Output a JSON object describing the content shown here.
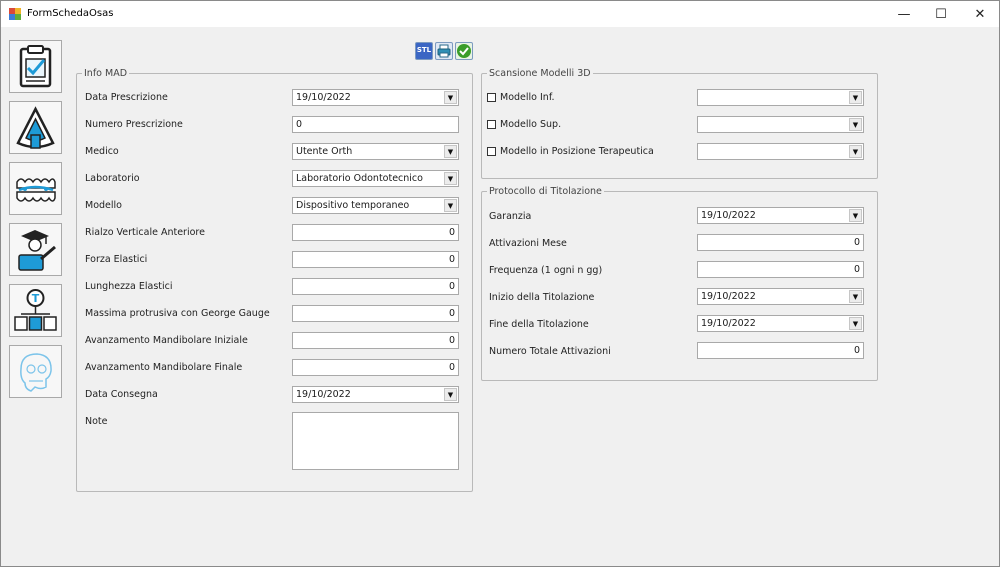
{
  "window": {
    "title": "FormSchedaOsas",
    "minimize": "—",
    "maximize": "☐",
    "close": "✕"
  },
  "toolbar": {
    "stl_label": "STL"
  },
  "info_mad": {
    "legend": "Info MAD",
    "data_prescrizione": {
      "label": "Data Prescrizione",
      "value": "19/10/2022"
    },
    "numero_prescrizione": {
      "label": "Numero Prescrizione",
      "value": "0"
    },
    "medico": {
      "label": "Medico",
      "value": "Utente Orth"
    },
    "laboratorio": {
      "label": "Laboratorio",
      "value": "Laboratorio Odontotecnico"
    },
    "modello": {
      "label": "Modello",
      "value": "Dispositivo temporaneo"
    },
    "rialzo": {
      "label": "Rialzo Verticale Anteriore",
      "value": "0"
    },
    "forza_elastici": {
      "label": "Forza Elastici",
      "value": "0"
    },
    "lunghezza_elastici": {
      "label": "Lunghezza Elastici",
      "value": "0"
    },
    "massima_protrusiva": {
      "label": "Massima protrusiva con George Gauge",
      "value": "0"
    },
    "avanz_iniziale": {
      "label": "Avanzamento Mandibolare Iniziale",
      "value": "0"
    },
    "avanz_finale": {
      "label": "Avanzamento Mandibolare Finale",
      "value": "0"
    },
    "data_consegna": {
      "label": "Data Consegna",
      "value": "19/10/2022"
    },
    "note": {
      "label": "Note",
      "value": ""
    }
  },
  "scansione": {
    "legend": "Scansione Modelli 3D",
    "modello_inf": {
      "label": "Modello Inf.",
      "value": ""
    },
    "modello_sup": {
      "label": "Modello Sup.",
      "value": ""
    },
    "modello_terapeutica": {
      "label": "Modello in Posizione Terapeutica",
      "value": ""
    }
  },
  "protocollo": {
    "legend": "Protocollo di Titolazione",
    "garanzia": {
      "label": "Garanzia",
      "value": "19/10/2022"
    },
    "attivazioni_mese": {
      "label": "Attivazioni Mese",
      "value": "0"
    },
    "frequenza": {
      "label": "Frequenza (1 ogni n gg)",
      "value": "0"
    },
    "inizio": {
      "label": "Inizio della Titolazione",
      "value": "19/10/2022"
    },
    "fine": {
      "label": "Fine della Titolazione",
      "value": "19/10/2022"
    },
    "totale": {
      "label": "Numero Totale Attivazioni",
      "value": "0"
    }
  },
  "colors": {
    "sidebar_icon_blue": "#1e9bd7",
    "save_green": "#3a9d2a",
    "stl_blue": "#3b66c4"
  }
}
